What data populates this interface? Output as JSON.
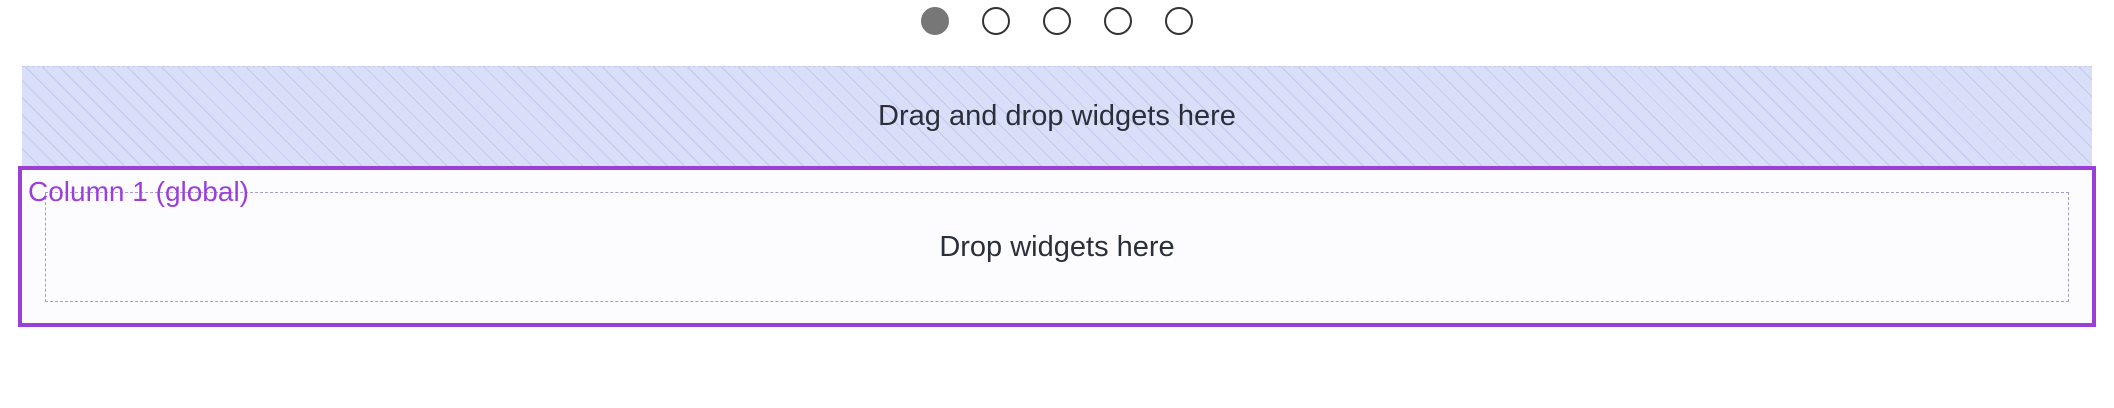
{
  "pagination": {
    "dots": [
      {
        "state": "active"
      },
      {
        "state": "inactive"
      },
      {
        "state": "inactive"
      },
      {
        "state": "inactive"
      },
      {
        "state": "inactive"
      }
    ],
    "active_index": 0
  },
  "top_dropzone": {
    "label": "Drag and drop widgets here"
  },
  "column": {
    "title": "Column 1 (global)",
    "drop_label": "Drop widgets here"
  },
  "colors": {
    "column_border": "#9b3fd9",
    "dropzone_background": "#dadff9",
    "active_dot": "#777777"
  }
}
